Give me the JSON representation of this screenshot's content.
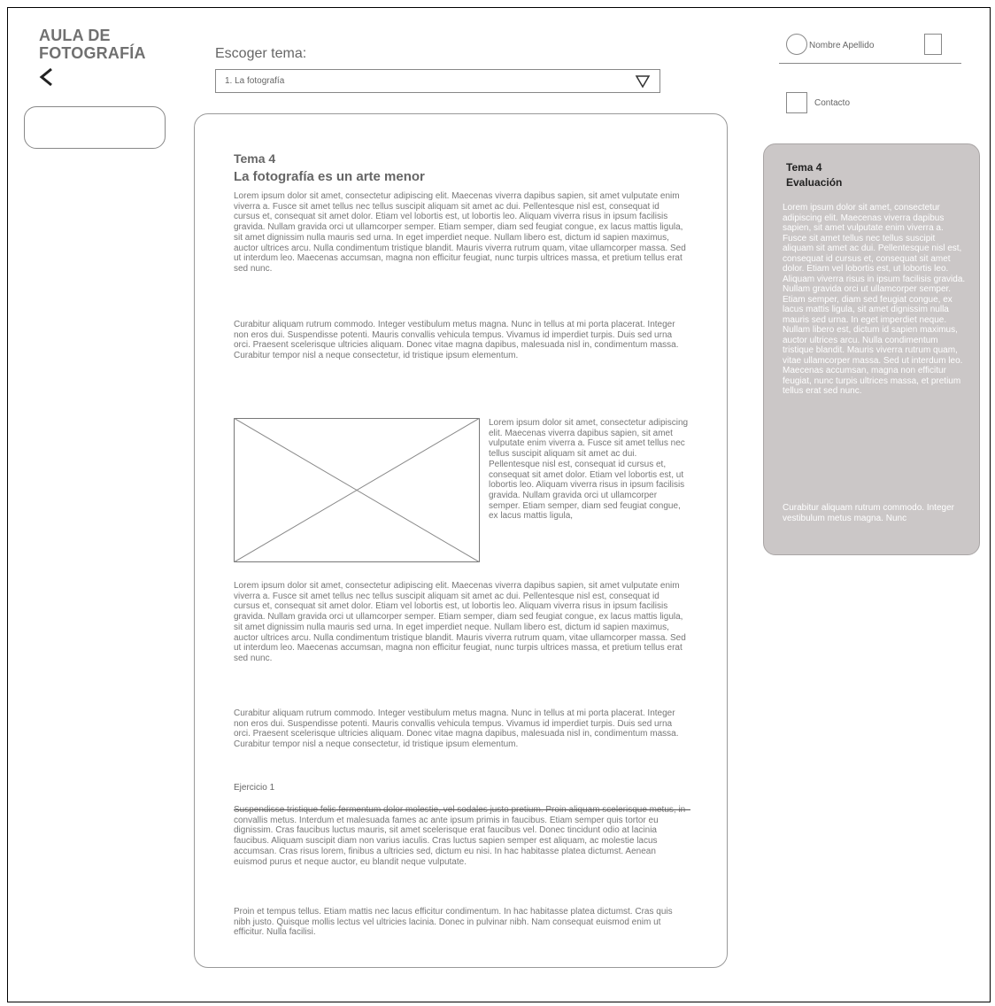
{
  "app": {
    "brand_line1": "AULA DE",
    "brand_line2": "FOTOGRAFÍA"
  },
  "header": {
    "choose_topic_label": "Escoger tema:",
    "selected_topic": "1. La fotografía"
  },
  "user": {
    "name": "Nombre Apellido",
    "contact_label": "Contacto"
  },
  "content": {
    "theme_number": "Tema 4",
    "theme_title": "La fotografía es un arte menor",
    "para1": "Lorem ipsum dolor sit amet, consectetur adipiscing elit. Maecenas viverra dapibus sapien, sit amet vulputate enim viverra a. Fusce sit amet tellus nec tellus suscipit aliquam sit amet ac dui. Pellentesque nisl est, consequat id cursus et, consequat sit amet dolor. Etiam vel lobortis est, ut lobortis leo. Aliquam viverra risus in ipsum facilisis gravida. Nullam gravida orci ut ullamcorper semper. Etiam semper, diam sed feugiat congue, ex lacus mattis ligula, sit amet dignissim nulla mauris sed urna. In eget imperdiet neque. Nullam libero est, dictum id sapien maximus, auctor ultrices arcu. Nulla condimentum tristique blandit. Mauris viverra rutrum quam, vitae ullamcorper massa. Sed ut interdum leo. Maecenas accumsan, magna non efficitur feugiat, nunc turpis ultrices massa, et pretium tellus erat sed nunc.",
    "para2": "Curabitur aliquam rutrum commodo. Integer vestibulum metus magna. Nunc in tellus at mi porta placerat. Integer non eros dui. Suspendisse potenti. Mauris convallis vehicula tempus. Vivamus id imperdiet turpis. Duis sed urna orci. Praesent scelerisque ultricies aliquam. Donec vitae magna dapibus, malesuada nisl in, condimentum massa. Curabitur tempor nisl a neque consectetur, id tristique ipsum elementum.",
    "image_side_text": "Lorem ipsum dolor sit amet, consectetur adipiscing elit. Maecenas viverra dapibus sapien, sit amet vulputate enim viverra a. Fusce sit amet tellus nec tellus suscipit aliquam sit amet ac dui. Pellentesque nisl est, consequat id cursus et, consequat sit amet dolor. Etiam vel lobortis est, ut lobortis leo. Aliquam viverra risus in ipsum facilisis gravida. Nullam gravida orci ut ullamcorper semper. Etiam semper, diam sed feugiat congue, ex lacus mattis ligula,",
    "para3": "Lorem ipsum dolor sit amet, consectetur adipiscing elit. Maecenas viverra dapibus sapien, sit amet vulputate enim viverra a. Fusce sit amet tellus nec tellus suscipit aliquam sit amet ac dui. Pellentesque nisl est, consequat id cursus et, consequat sit amet dolor. Etiam vel lobortis est, ut lobortis leo. Aliquam viverra risus in ipsum facilisis gravida. Nullam gravida orci ut ullamcorper semper. Etiam semper, diam sed feugiat congue, ex lacus mattis ligula, sit amet dignissim nulla mauris sed urna. In eget imperdiet neque. Nullam libero est, dictum id sapien maximus, auctor ultrices arcu. Nulla condimentum tristique blandit. Mauris viverra rutrum quam, vitae ullamcorper massa. Sed ut interdum leo. Maecenas accumsan, magna non efficitur feugiat, nunc turpis ultrices massa, et pretium tellus erat sed nunc.",
    "para4": "Curabitur aliquam rutrum commodo. Integer vestibulum metus magna. Nunc in tellus at mi porta placerat. Integer non eros dui. Suspendisse potenti. Mauris convallis vehicula tempus. Vivamus id imperdiet turpis. Duis sed urna orci. Praesent scelerisque ultricies aliquam. Donec vitae magna dapibus, malesuada nisl in, condimentum massa. Curabitur tempor nisl a neque consectetur, id tristique ipsum elementum.",
    "exercise_title": "Ejercicio 1",
    "exercise_para1": "Suspendisse tristique felis fermentum dolor molestie, vel sodales justo pretium. Proin aliquam scelerisque metus, in convallis metus. Interdum et malesuada fames ac ante ipsum primis in faucibus. Etiam semper quis tortor eu dignissim. Cras faucibus luctus mauris, sit amet scelerisque erat faucibus vel. Donec tincidunt odio at lacinia faucibus. Aliquam suscipit diam non varius iaculis. Cras luctus sapien semper est aliquam, ac molestie lacus accumsan. Cras risus lorem, finibus a ultricies sed, dictum eu nisi. In hac habitasse platea dictumst. Aenean euismod purus et neque auctor, eu blandit neque vulputate.",
    "exercise_para2": "Proin et tempus tellus. Etiam mattis nec lacus efficitur condimentum. In hac habitasse platea dictumst. Cras quis nibh justo. Quisque mollis lectus vel ultricies lacinia. Donec in pulvinar nibh. Nam consequat euismod enim ut efficitur. Nulla facilisi."
  },
  "evaluation": {
    "theme_number": "Tema 4",
    "title": "Evaluación",
    "para1": "Lorem ipsum dolor sit amet, consectetur adipiscing elit. Maecenas viverra dapibus sapien, sit amet vulputate enim viverra a. Fusce sit amet tellus nec tellus suscipit aliquam sit amet ac dui. Pellentesque nisl est, consequat id cursus et, consequat sit amet dolor. Etiam vel lobortis est, ut lobortis leo. Aliquam viverra risus in ipsum facilisis gravida. Nullam gravida orci ut ullamcorper semper. Etiam semper, diam sed feugiat congue, ex lacus mattis ligula, sit amet dignissim nulla mauris sed urna. In eget imperdiet neque. Nullam libero est, dictum id sapien maximus, auctor ultrices arcu. Nulla condimentum tristique blandit. Mauris viverra rutrum quam, vitae ullamcorper massa. Sed ut interdum leo. Maecenas accumsan, magna non efficitur feugiat, nunc turpis ultrices massa, et pretium tellus erat sed nunc.",
    "para2": "Curabitur aliquam rutrum commodo. Integer vestibulum metus magna. Nunc",
    "background_color": "#cbc7c7"
  },
  "icons": {
    "back": "chevron-left-icon",
    "dropdown": "triangle-down-icon",
    "user": "avatar-circle-icon",
    "image_placeholder": "image-placeholder-icon"
  }
}
